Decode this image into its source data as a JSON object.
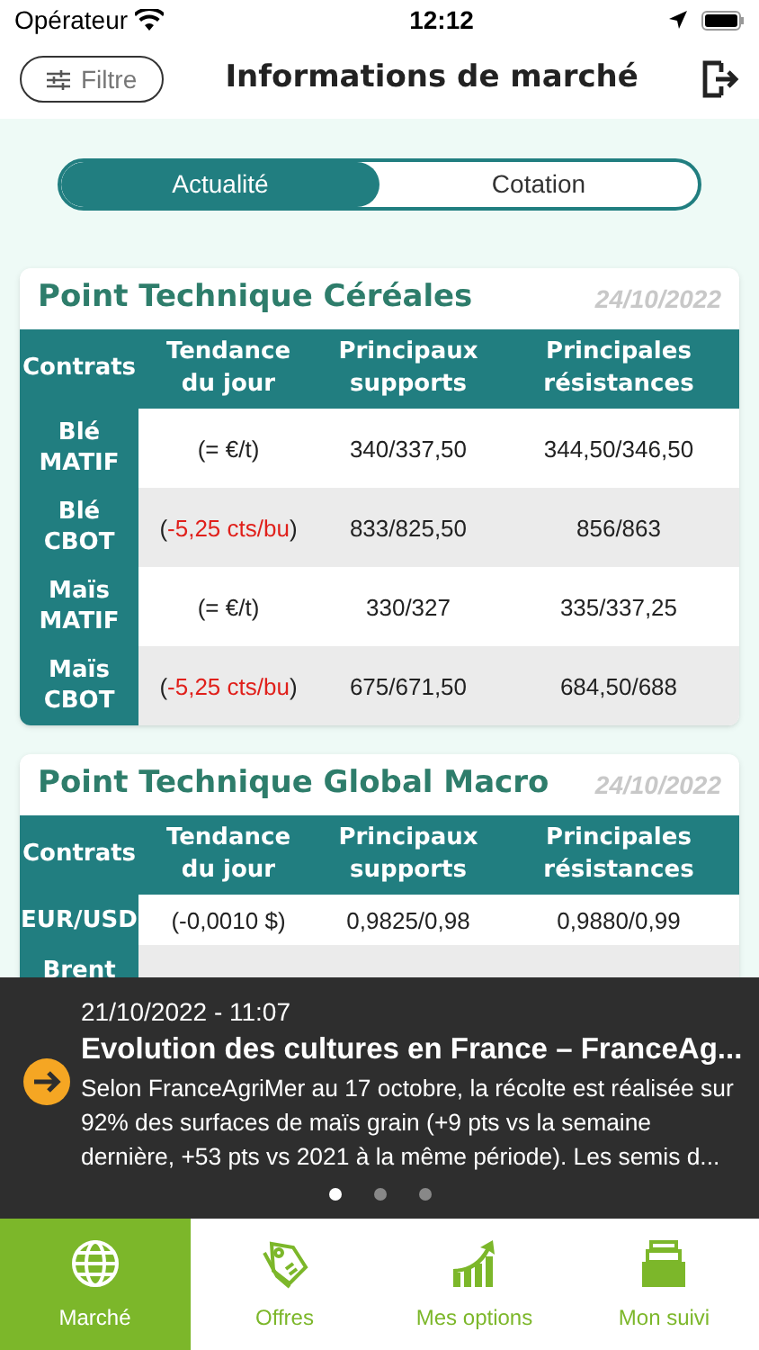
{
  "status_bar": {
    "carrier": "Opérateur",
    "time": "12:12"
  },
  "header": {
    "filter_button": "Filtre",
    "title": "Informations de marché"
  },
  "segments": [
    {
      "label": "Actualité",
      "selected": true
    },
    {
      "label": "Cotation",
      "selected": false
    }
  ],
  "cards": [
    {
      "title": "Point Technique Céréales",
      "date": "24/10/2022",
      "columns": [
        "Contrats",
        "Tendance du jour",
        "Principaux supports",
        "Principales résistances"
      ],
      "rows": [
        {
          "contract": "Blé MATIF",
          "trend": {
            "open": "(",
            "value": "= €/t",
            "close": ")",
            "alert": false
          },
          "supports": "340/337,50",
          "resistances": "344,50/346,50"
        },
        {
          "contract": "Blé CBOT",
          "trend": {
            "open": "(",
            "value": "-5,25 cts/bu",
            "close": ")",
            "alert": true
          },
          "supports": "833/825,50",
          "resistances": "856/863"
        },
        {
          "contract": "Maïs MATIF",
          "trend": {
            "open": "(",
            "value": "= €/t",
            "close": ")",
            "alert": false
          },
          "supports": "330/327",
          "resistances": "335/337,25"
        },
        {
          "contract": "Maïs CBOT",
          "trend": {
            "open": "(",
            "value": "-5,25 cts/bu",
            "close": ")",
            "alert": true
          },
          "supports": "675/671,50",
          "resistances": "684,50/688"
        }
      ]
    },
    {
      "title": "Point Technique Global Macro",
      "date": "24/10/2022",
      "columns": [
        "Contrats",
        "Tendance du jour",
        "Principaux supports",
        "Principales résistances"
      ],
      "rows": [
        {
          "contract": "EUR/USD",
          "trend": {
            "open": "(",
            "value": "-0,0010 $",
            "close": ")",
            "alert": false
          },
          "supports": "0,9825/0,98",
          "resistances": "0,9880/0,99"
        },
        {
          "contract": "Brent"
        }
      ]
    }
  ],
  "news": {
    "date": "21/10/2022 - 11:07",
    "title": "Evolution des cultures en France – FranceAg...",
    "body": "Selon FranceAgriMer au 17 octobre, la récolte est réalisée sur 92% des surfaces de maïs grain (+9 pts vs la semaine dernière, +53 pts vs 2021 à la même période). Les semis d...",
    "pages": [
      {
        "selected": true
      },
      {
        "selected": false
      },
      {
        "selected": false
      }
    ]
  },
  "tab_bar": [
    {
      "label": "Marché",
      "selected": true
    },
    {
      "label": "Offres",
      "selected": false
    },
    {
      "label": "Mes options",
      "selected": false
    },
    {
      "label": "Mon suivi",
      "selected": false
    }
  ]
}
